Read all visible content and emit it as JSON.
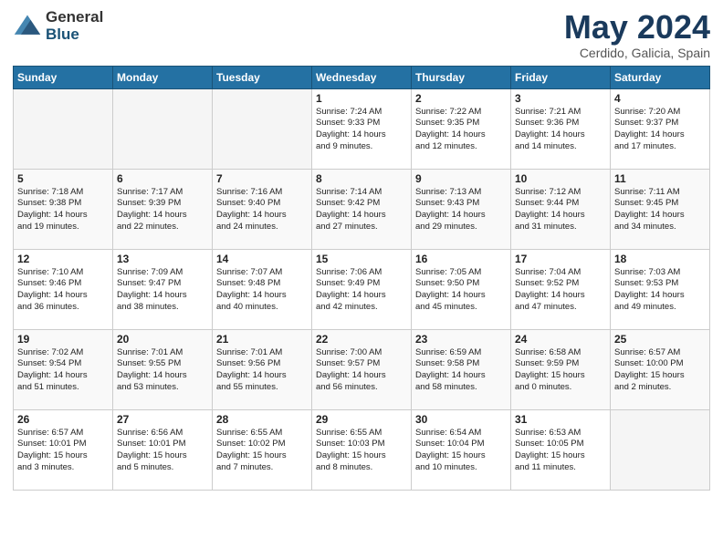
{
  "logo": {
    "general": "General",
    "blue": "Blue"
  },
  "title": "May 2024",
  "subtitle": "Cerdido, Galicia, Spain",
  "days_of_week": [
    "Sunday",
    "Monday",
    "Tuesday",
    "Wednesday",
    "Thursday",
    "Friday",
    "Saturday"
  ],
  "weeks": [
    [
      {
        "day": "",
        "info": ""
      },
      {
        "day": "",
        "info": ""
      },
      {
        "day": "",
        "info": ""
      },
      {
        "day": "1",
        "info": "Sunrise: 7:24 AM\nSunset: 9:33 PM\nDaylight: 14 hours\nand 9 minutes."
      },
      {
        "day": "2",
        "info": "Sunrise: 7:22 AM\nSunset: 9:35 PM\nDaylight: 14 hours\nand 12 minutes."
      },
      {
        "day": "3",
        "info": "Sunrise: 7:21 AM\nSunset: 9:36 PM\nDaylight: 14 hours\nand 14 minutes."
      },
      {
        "day": "4",
        "info": "Sunrise: 7:20 AM\nSunset: 9:37 PM\nDaylight: 14 hours\nand 17 minutes."
      }
    ],
    [
      {
        "day": "5",
        "info": "Sunrise: 7:18 AM\nSunset: 9:38 PM\nDaylight: 14 hours\nand 19 minutes."
      },
      {
        "day": "6",
        "info": "Sunrise: 7:17 AM\nSunset: 9:39 PM\nDaylight: 14 hours\nand 22 minutes."
      },
      {
        "day": "7",
        "info": "Sunrise: 7:16 AM\nSunset: 9:40 PM\nDaylight: 14 hours\nand 24 minutes."
      },
      {
        "day": "8",
        "info": "Sunrise: 7:14 AM\nSunset: 9:42 PM\nDaylight: 14 hours\nand 27 minutes."
      },
      {
        "day": "9",
        "info": "Sunrise: 7:13 AM\nSunset: 9:43 PM\nDaylight: 14 hours\nand 29 minutes."
      },
      {
        "day": "10",
        "info": "Sunrise: 7:12 AM\nSunset: 9:44 PM\nDaylight: 14 hours\nand 31 minutes."
      },
      {
        "day": "11",
        "info": "Sunrise: 7:11 AM\nSunset: 9:45 PM\nDaylight: 14 hours\nand 34 minutes."
      }
    ],
    [
      {
        "day": "12",
        "info": "Sunrise: 7:10 AM\nSunset: 9:46 PM\nDaylight: 14 hours\nand 36 minutes."
      },
      {
        "day": "13",
        "info": "Sunrise: 7:09 AM\nSunset: 9:47 PM\nDaylight: 14 hours\nand 38 minutes."
      },
      {
        "day": "14",
        "info": "Sunrise: 7:07 AM\nSunset: 9:48 PM\nDaylight: 14 hours\nand 40 minutes."
      },
      {
        "day": "15",
        "info": "Sunrise: 7:06 AM\nSunset: 9:49 PM\nDaylight: 14 hours\nand 42 minutes."
      },
      {
        "day": "16",
        "info": "Sunrise: 7:05 AM\nSunset: 9:50 PM\nDaylight: 14 hours\nand 45 minutes."
      },
      {
        "day": "17",
        "info": "Sunrise: 7:04 AM\nSunset: 9:52 PM\nDaylight: 14 hours\nand 47 minutes."
      },
      {
        "day": "18",
        "info": "Sunrise: 7:03 AM\nSunset: 9:53 PM\nDaylight: 14 hours\nand 49 minutes."
      }
    ],
    [
      {
        "day": "19",
        "info": "Sunrise: 7:02 AM\nSunset: 9:54 PM\nDaylight: 14 hours\nand 51 minutes."
      },
      {
        "day": "20",
        "info": "Sunrise: 7:01 AM\nSunset: 9:55 PM\nDaylight: 14 hours\nand 53 minutes."
      },
      {
        "day": "21",
        "info": "Sunrise: 7:01 AM\nSunset: 9:56 PM\nDaylight: 14 hours\nand 55 minutes."
      },
      {
        "day": "22",
        "info": "Sunrise: 7:00 AM\nSunset: 9:57 PM\nDaylight: 14 hours\nand 56 minutes."
      },
      {
        "day": "23",
        "info": "Sunrise: 6:59 AM\nSunset: 9:58 PM\nDaylight: 14 hours\nand 58 minutes."
      },
      {
        "day": "24",
        "info": "Sunrise: 6:58 AM\nSunset: 9:59 PM\nDaylight: 15 hours\nand 0 minutes."
      },
      {
        "day": "25",
        "info": "Sunrise: 6:57 AM\nSunset: 10:00 PM\nDaylight: 15 hours\nand 2 minutes."
      }
    ],
    [
      {
        "day": "26",
        "info": "Sunrise: 6:57 AM\nSunset: 10:01 PM\nDaylight: 15 hours\nand 3 minutes."
      },
      {
        "day": "27",
        "info": "Sunrise: 6:56 AM\nSunset: 10:01 PM\nDaylight: 15 hours\nand 5 minutes."
      },
      {
        "day": "28",
        "info": "Sunrise: 6:55 AM\nSunset: 10:02 PM\nDaylight: 15 hours\nand 7 minutes."
      },
      {
        "day": "29",
        "info": "Sunrise: 6:55 AM\nSunset: 10:03 PM\nDaylight: 15 hours\nand 8 minutes."
      },
      {
        "day": "30",
        "info": "Sunrise: 6:54 AM\nSunset: 10:04 PM\nDaylight: 15 hours\nand 10 minutes."
      },
      {
        "day": "31",
        "info": "Sunrise: 6:53 AM\nSunset: 10:05 PM\nDaylight: 15 hours\nand 11 minutes."
      },
      {
        "day": "",
        "info": ""
      }
    ]
  ]
}
